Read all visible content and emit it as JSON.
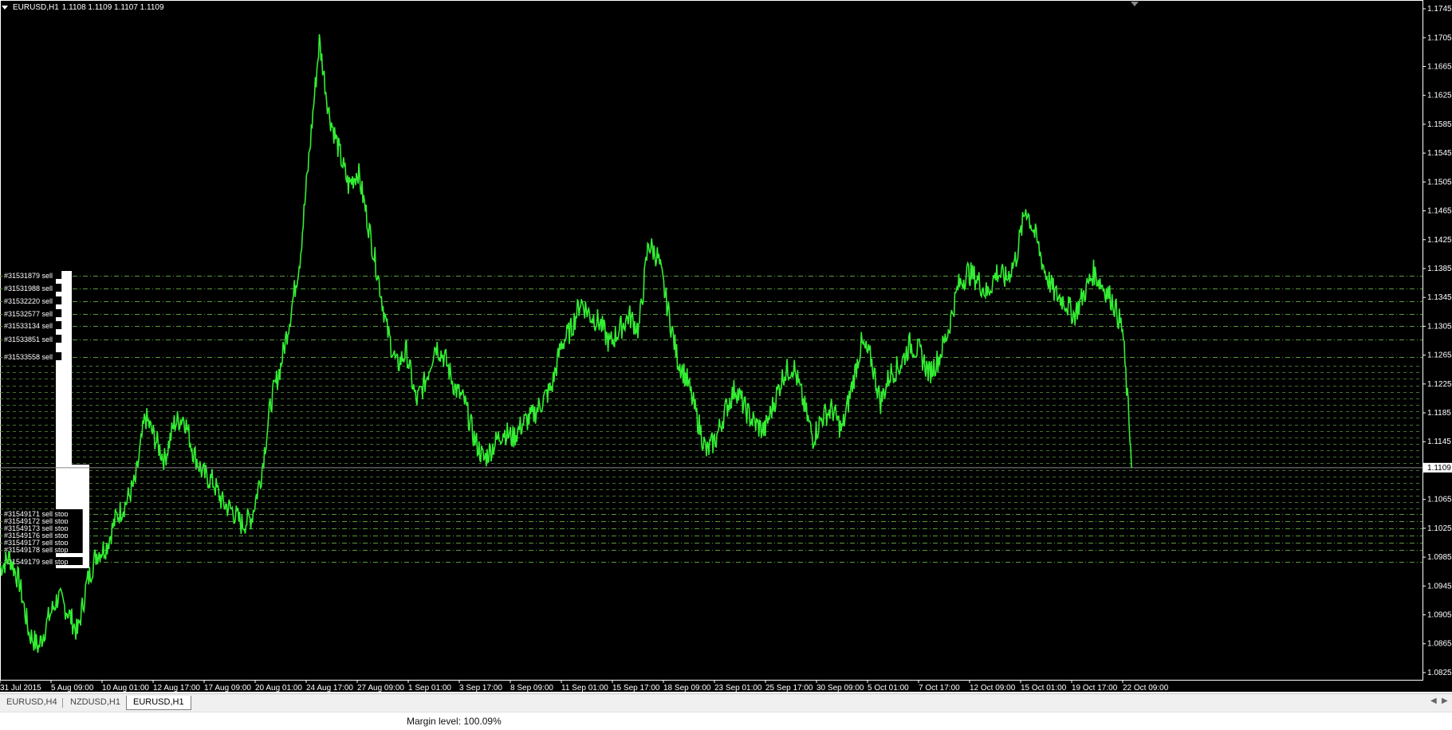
{
  "window": {
    "symbol_header": "EURUSD,H1",
    "ohlc": "1.1108 1.1109 1.1107 1.1109"
  },
  "colors": {
    "background": "#000000",
    "price_line": "#33ee33",
    "order_line": "#5a9a3a",
    "axis_text": "#ffffff"
  },
  "chart_data": {
    "type": "line",
    "symbol": "EURUSD",
    "timeframe": "H1",
    "current_price": "1.1109",
    "y_ticks": [
      "1.1745",
      "1.1705",
      "1.1665",
      "1.1625",
      "1.1585",
      "1.1545",
      "1.1505",
      "1.1465",
      "1.1425",
      "1.1385",
      "1.1345",
      "1.1305",
      "1.1265",
      "1.1225",
      "1.1185",
      "1.1145",
      "1.1109",
      "1.1065",
      "1.1025",
      "1.0985",
      "1.0945",
      "1.0905",
      "1.0865",
      "1.0825"
    ],
    "x_ticks": [
      "31 Jul 2015",
      "5 Aug 09:00",
      "10 Aug 01:00",
      "12 Aug 17:00",
      "17 Aug 09:00",
      "20 Aug 01:00",
      "24 Aug 17:00",
      "27 Aug 09:00",
      "1 Sep 01:00",
      "3 Sep 17:00",
      "8 Sep 09:00",
      "11 Sep 01:00",
      "15 Sep 17:00",
      "18 Sep 09:00",
      "23 Sep 01:00",
      "25 Sep 17:00",
      "30 Sep 09:00",
      "5 Oct 01:00",
      "7 Oct 17:00",
      "12 Oct 09:00",
      "15 Oct 01:00",
      "19 Oct 17:00",
      "22 Oct 09:00"
    ],
    "ylim": [
      1.0815,
      1.1755
    ],
    "series": [
      {
        "values": [
          1.097,
          1.0985,
          1.095,
          1.088,
          1.086,
          1.09,
          1.093,
          1.091,
          1.088,
          1.095,
          1.099,
          1.1,
          1.104,
          1.106,
          1.109,
          1.118,
          1.115,
          1.112,
          1.117,
          1.118,
          1.113,
          1.11,
          1.109,
          1.106,
          1.105,
          1.103,
          1.104,
          1.11,
          1.12,
          1.125,
          1.132,
          1.14,
          1.155,
          1.17,
          1.16,
          1.155,
          1.15,
          1.152,
          1.145,
          1.138,
          1.13,
          1.125,
          1.127,
          1.12,
          1.123,
          1.128,
          1.126,
          1.122,
          1.12,
          1.115,
          1.112,
          1.114,
          1.116,
          1.115,
          1.117,
          1.118,
          1.12,
          1.122,
          1.128,
          1.13,
          1.134,
          1.132,
          1.131,
          1.128,
          1.13,
          1.132,
          1.13,
          1.142,
          1.14,
          1.133,
          1.126,
          1.123,
          1.118,
          1.113,
          1.115,
          1.119,
          1.122,
          1.119,
          1.117,
          1.116,
          1.12,
          1.124,
          1.125,
          1.12,
          1.115,
          1.118,
          1.119,
          1.116,
          1.122,
          1.128,
          1.126,
          1.12,
          1.124,
          1.125,
          1.128,
          1.127,
          1.124,
          1.126,
          1.13,
          1.136,
          1.138,
          1.137,
          1.135,
          1.138,
          1.137,
          1.14,
          1.147,
          1.143,
          1.138,
          1.135,
          1.134,
          1.132,
          1.135,
          1.138,
          1.136,
          1.134,
          1.13,
          1.1109
        ]
      }
    ]
  },
  "orders": [
    {
      "label": "#31531879 sell",
      "price": 1.1375
    },
    {
      "label": "#31531988 sell",
      "price": 1.1357
    },
    {
      "label": "#31532220 sell",
      "price": 1.134
    },
    {
      "label": "#31532577 sell",
      "price": 1.1322
    },
    {
      "label": "#31533134 sell",
      "price": 1.1305
    },
    {
      "label": "#31533851 sell",
      "price": 1.1287
    },
    {
      "label": "#31533558 sell",
      "price": 1.1262
    },
    {
      "label": "#31549171 sell stop",
      "price": 1.1045
    },
    {
      "label": "#31549172 sell stop",
      "price": 1.1035
    },
    {
      "label": "#31549173 sell stop",
      "price": 1.1025
    },
    {
      "label": "#31549176 sell stop",
      "price": 1.1015
    },
    {
      "label": "#31549177 sell stop",
      "price": 1.1005
    },
    {
      "label": "#31549178 sell stop",
      "price": 1.0995
    },
    {
      "label": "#31549179 sell stop",
      "price": 1.0978
    }
  ],
  "tabs": [
    {
      "label": "EURUSD,H4",
      "active": false
    },
    {
      "label": "NZDUSD,H1",
      "active": false
    },
    {
      "label": "EURUSD,H1",
      "active": true
    }
  ],
  "status": {
    "margin_level": "Margin level: 100.09%"
  }
}
